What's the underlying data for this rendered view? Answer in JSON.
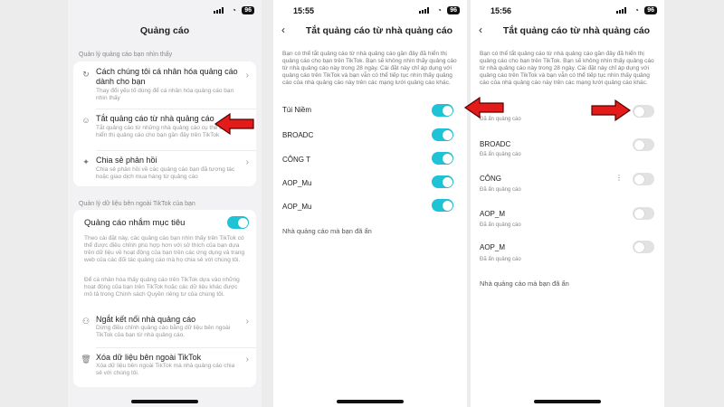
{
  "colors": {
    "accent": "#1fc3d6",
    "arrow": "#e31b1b"
  },
  "phone1": {
    "title": "Quảng cáo",
    "section1_label": "Quản lý quảng cáo bạn nhìn thấy",
    "items": [
      {
        "icon": "personalize-icon",
        "title": "Cách chúng tôi cá nhân hóa quảng cáo dành cho bạn",
        "desc": "Thay đổi yếu tố dùng để cá nhân hóa quảng cáo bạn nhìn thấy"
      },
      {
        "icon": "users-icon",
        "title": "Tắt quảng cáo từ nhà quảng cáo",
        "desc": "Tắt quảng cáo từ những nhà quảng cáo cụ thể đã hiển thị quảng cáo cho bạn gần đây trên TikTok"
      },
      {
        "icon": "sparkle-icon",
        "title": "Chia sẻ phản hồi",
        "desc": "Chia sẻ phản hồi về các quảng cáo bạn đã tương tác hoặc giao dịch mua hàng từ quảng cáo"
      }
    ],
    "section2_label": "Quản lý dữ liệu bên ngoài TikTok của bạn",
    "targeted": {
      "title": "Quảng cáo nhắm mục tiêu",
      "toggle_on": true,
      "desc": "Theo cài đặt này, các quảng cáo bạn nhìn thấy trên TikTok có thể được điều chỉnh phù hợp hơn với sở thích của bạn dựa trên dữ liệu về hoạt động của bạn trên các ứng dụng và trang web của các đối tác quảng cáo mà họ chia sẻ với chúng tôi.",
      "desc2": "Để cá nhân hóa thấy quảng cáo trên TikTok dựa vào những hoạt động của bạn trên TikTok hoặc các dữ liệu khác được mô tả trong Chính sách Quyền riêng tư của chúng tôi."
    },
    "items2": [
      {
        "icon": "disconnect-icon",
        "title": "Ngắt kết nối nhà quảng cáo",
        "desc": "Dừng điều chỉnh quảng cáo bằng dữ liệu bên ngoài TikTok của bạn từ nhà quảng cáo."
      },
      {
        "icon": "trash-icon",
        "title": "Xóa dữ liệu bên ngoài TikTok",
        "desc": "Xóa dữ liệu bên ngoài TikTok mà nhà quảng cáo chia sẻ với chúng tôi."
      }
    ]
  },
  "phone2": {
    "time": "15:55",
    "battery": "96",
    "title": "Tắt quảng cáo từ nhà quảng cáo",
    "intro": "Bạn có thể tắt quảng cáo từ nhà quảng cáo gần đây đã hiển thị quảng cáo cho bạn trên TikTok. Bạn sẽ không nhìn thấy quảng cáo từ nhà quảng cáo này trong 28 ngày. Cài đặt này chỉ áp dụng với quảng cáo trên TikTok và bạn vẫn có thể tiếp tục nhìn thấy quảng cáo của nhà quảng cáo này trên các mạng lưới quảng cáo khác.",
    "advertisers": [
      {
        "name": "Túi Niềm",
        "on": true
      },
      {
        "name": "BROADC",
        "on": true
      },
      {
        "name": "CÔNG T",
        "on": true
      },
      {
        "name": "AOP_Mu",
        "on": true
      },
      {
        "name": "AOP_Mu",
        "on": true
      }
    ],
    "hidden_link": "Nhà quảng cáo mà bạn đã ẩn"
  },
  "phone3": {
    "time": "15:56",
    "battery": "96",
    "title": "Tắt quảng cáo từ nhà quảng cáo",
    "intro": "Bạn có thể tắt quảng cáo từ nhà quảng cáo gần đây đã hiển thị quảng cáo cho bạn trên TikTok. Bạn sẽ không nhìn thấy quảng cáo từ nhà quảng cáo này trong 28 ngày. Cài đặt này chỉ áp dụng với quảng cáo trên TikTok và bạn vẫn có thể tiếp tục nhìn thấy quảng cáo của nhà quảng cáo này trên các mạng lưới quảng cáo khác.",
    "advertisers": [
      {
        "name": "",
        "sub": "Đã ẩn quảng cáo",
        "on": false
      },
      {
        "name": "BROADC",
        "sub": "Đã ẩn quảng cáo",
        "on": false
      },
      {
        "name": "CÔNG",
        "sub": "Đã ẩn quảng cáo",
        "on": false
      },
      {
        "name": "AOP_M",
        "sub": "Đã ẩn quảng cáo",
        "on": false
      },
      {
        "name": "AOP_M",
        "sub": "Đã ẩn quảng cáo",
        "on": false
      }
    ],
    "hidden_link": "Nhà quảng cáo mà bạn đã ẩn"
  }
}
